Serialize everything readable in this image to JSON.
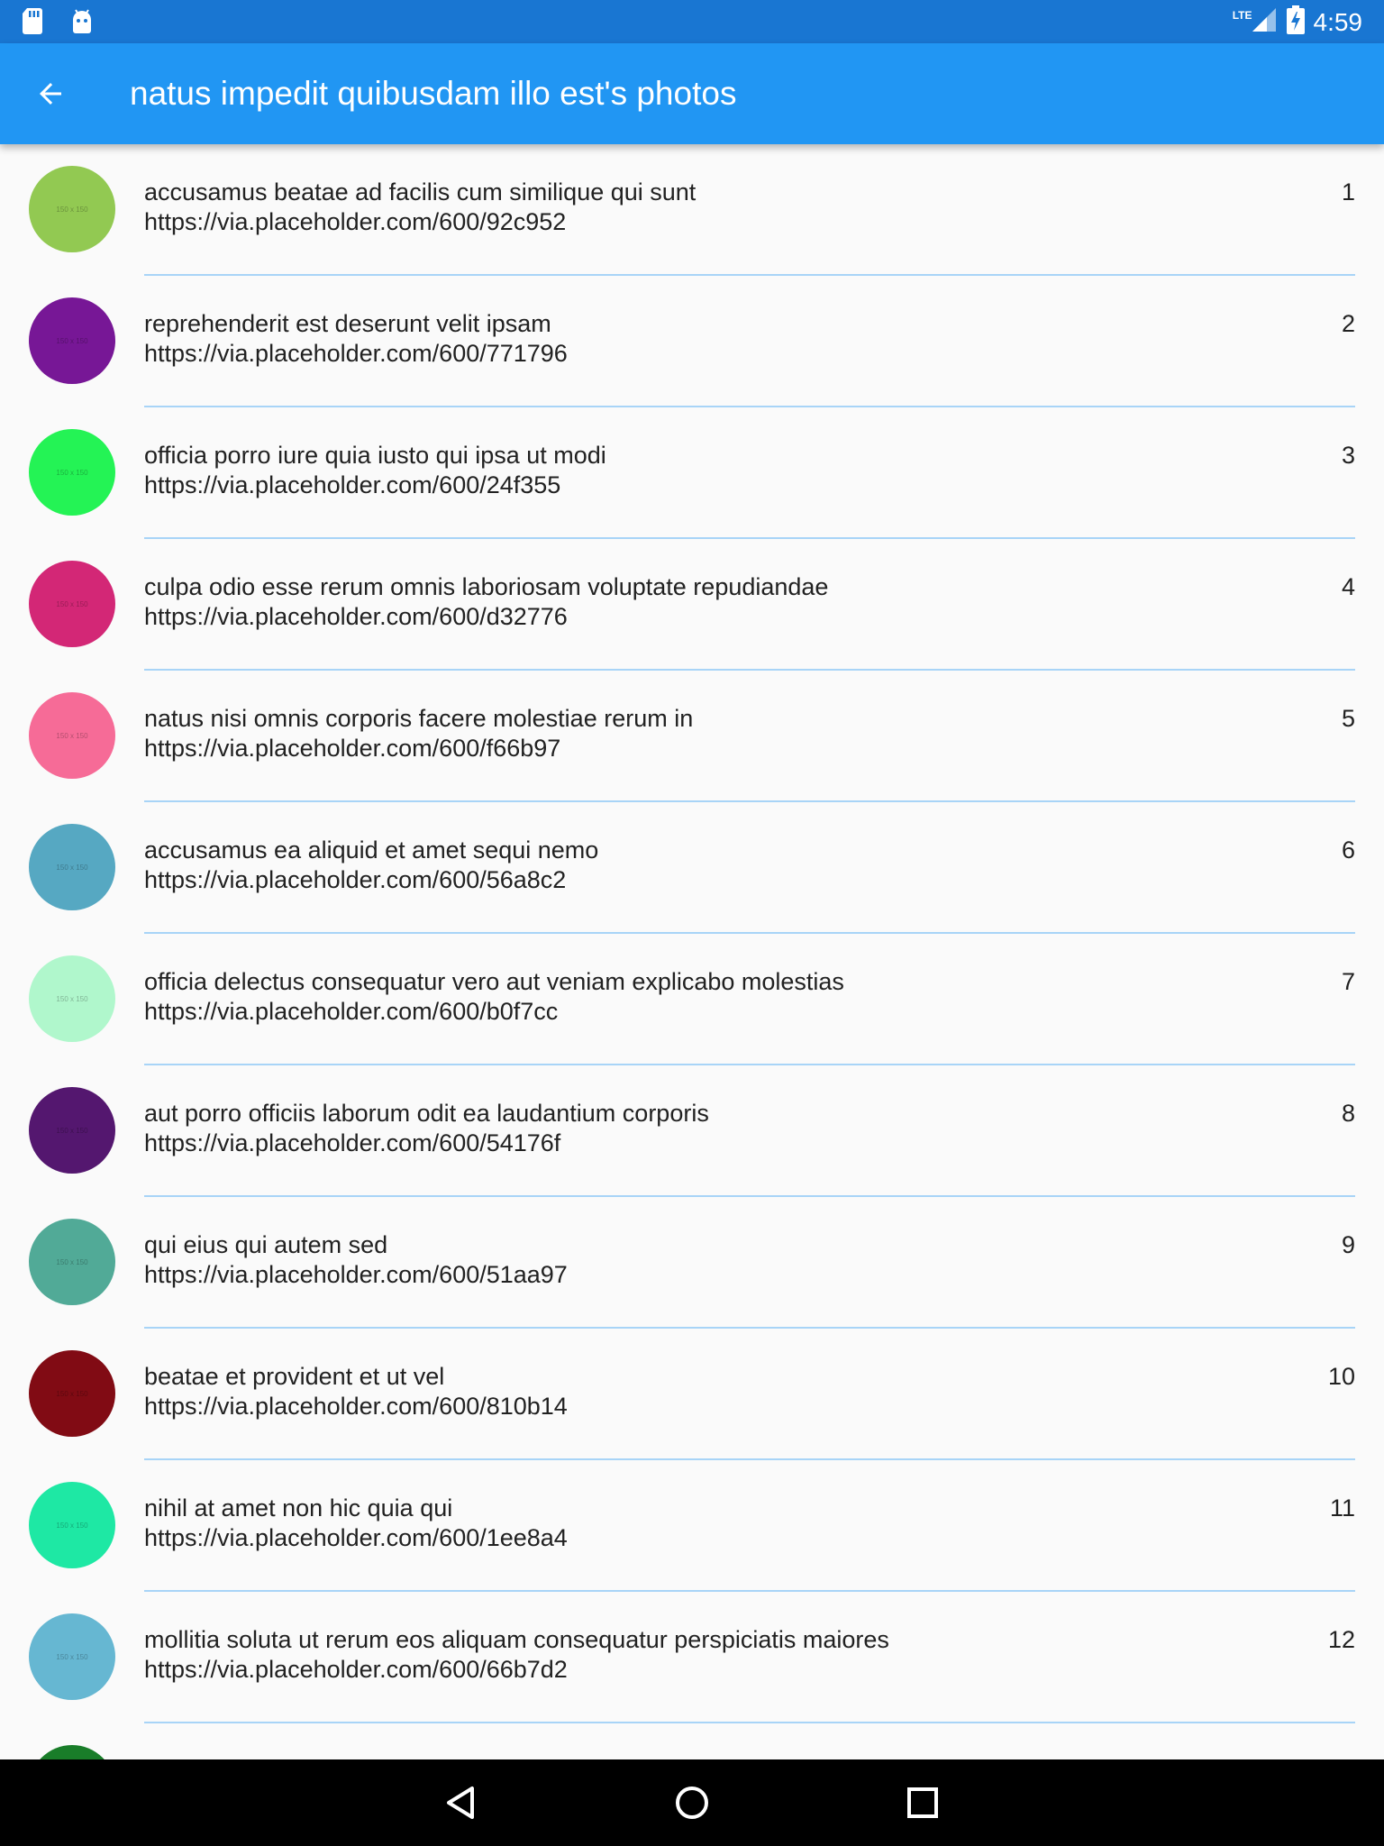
{
  "status_bar": {
    "network": "LTE",
    "time": "4:59",
    "icons": [
      "sd-card-icon",
      "android-icon",
      "signal-icon",
      "battery-charging-icon"
    ]
  },
  "app_bar": {
    "title": "natus impedit quibusdam illo est's photos",
    "back_icon": "arrow-back-icon"
  },
  "photos": [
    {
      "title": "accusamus beatae ad facilis cum similique qui sunt",
      "url": "https://via.placeholder.com/600/92c952",
      "index": "1",
      "color": "#92c952",
      "thumb_text": "150 x 150"
    },
    {
      "title": "reprehenderit est deserunt velit ipsam",
      "url": "https://via.placeholder.com/600/771796",
      "index": "2",
      "color": "#771796",
      "thumb_text": "150 x 150"
    },
    {
      "title": "officia porro iure quia iusto qui ipsa ut modi",
      "url": "https://via.placeholder.com/600/24f355",
      "index": "3",
      "color": "#24f355",
      "thumb_text": "150 x 150"
    },
    {
      "title": "culpa odio esse rerum omnis laboriosam voluptate repudiandae",
      "url": "https://via.placeholder.com/600/d32776",
      "index": "4",
      "color": "#d32776",
      "thumb_text": "150 x 150"
    },
    {
      "title": "natus nisi omnis corporis facere molestiae rerum in",
      "url": "https://via.placeholder.com/600/f66b97",
      "index": "5",
      "color": "#f66b97",
      "thumb_text": "150 x 150"
    },
    {
      "title": "accusamus ea aliquid et amet sequi nemo",
      "url": "https://via.placeholder.com/600/56a8c2",
      "index": "6",
      "color": "#56a8c2",
      "thumb_text": "150 x 150"
    },
    {
      "title": "officia delectus consequatur vero aut veniam explicabo molestias",
      "url": "https://via.placeholder.com/600/b0f7cc",
      "index": "7",
      "color": "#b0f7cc",
      "thumb_text": "150 x 150"
    },
    {
      "title": "aut porro officiis laborum odit ea laudantium corporis",
      "url": "https://via.placeholder.com/600/54176f",
      "index": "8",
      "color": "#54176f",
      "thumb_text": "150 x 150"
    },
    {
      "title": "qui eius qui autem sed",
      "url": "https://via.placeholder.com/600/51aa97",
      "index": "9",
      "color": "#51aa97",
      "thumb_text": "150 x 150"
    },
    {
      "title": "beatae et provident et ut vel",
      "url": "https://via.placeholder.com/600/810b14",
      "index": "10",
      "color": "#810b14",
      "thumb_text": "150 x 150"
    },
    {
      "title": "nihil at amet non hic quia qui",
      "url": "https://via.placeholder.com/600/1ee8a4",
      "index": "11",
      "color": "#1ee8a4",
      "thumb_text": "150 x 150"
    },
    {
      "title": "mollitia soluta ut rerum eos aliquam consequatur perspiciatis maiores",
      "url": "https://via.placeholder.com/600/66b7d2",
      "index": "12",
      "color": "#66b7d2",
      "thumb_text": "150 x 150"
    },
    {
      "title": "",
      "url": "",
      "index": "",
      "color": "#197d29",
      "thumb_text": ""
    }
  ],
  "nav_bar": {
    "buttons": [
      "back-triangle-icon",
      "home-circle-icon",
      "recents-square-icon"
    ]
  },
  "colors": {
    "status_bar": "#1976d2",
    "app_bar": "#2196f3",
    "divider": "#a8d4f7",
    "background": "#fafafa"
  }
}
